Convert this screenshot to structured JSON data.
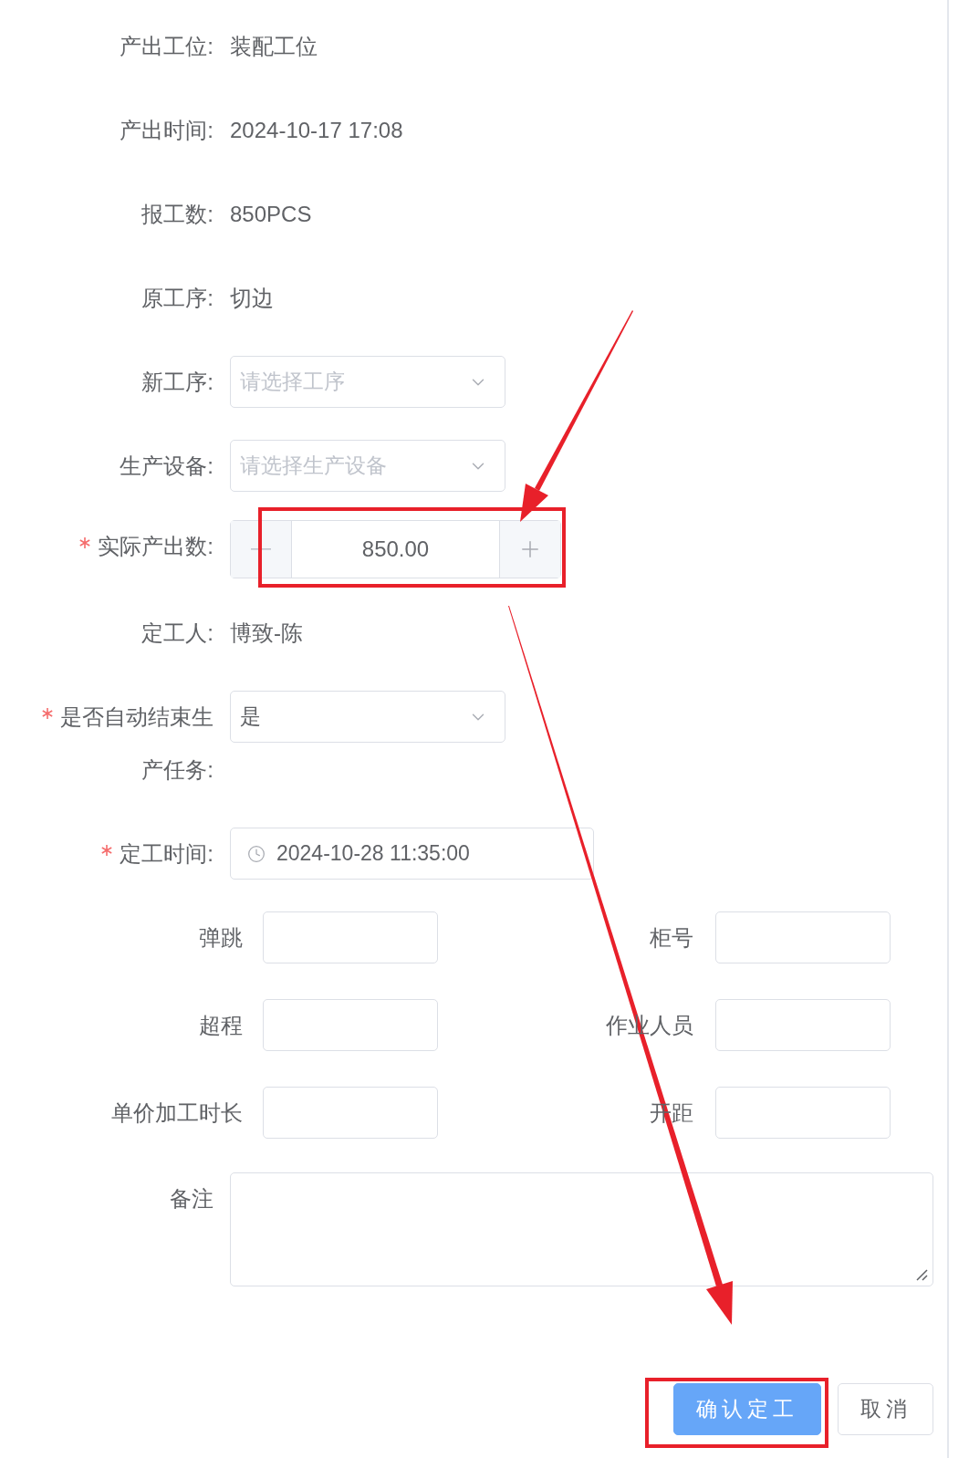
{
  "form": {
    "rows": [
      {
        "kind": "text",
        "label": "产出工位:",
        "required": false,
        "value": "装配工位"
      },
      {
        "kind": "text",
        "label": "产出时间:",
        "required": false,
        "value": "2024-10-17 17:08"
      },
      {
        "kind": "text",
        "label": "报工数:",
        "required": false,
        "value": "850PCS"
      },
      {
        "kind": "text",
        "label": "原工序:",
        "required": false,
        "value": "切边"
      },
      {
        "kind": "select",
        "label": "新工序:",
        "required": false,
        "placeholder": "请选择工序"
      },
      {
        "kind": "select",
        "label": "生产设备:",
        "required": false,
        "placeholder": "请选择生产设备"
      },
      {
        "kind": "number",
        "label": "实际产出数:",
        "required": true,
        "value": "850.00"
      },
      {
        "kind": "text",
        "label": "定工人:",
        "required": false,
        "value": "博致-陈"
      },
      {
        "kind": "select",
        "label": "是否自动结束生产任务:",
        "required": true,
        "value": "是"
      },
      {
        "kind": "datetime",
        "label": "定工时间:",
        "required": true,
        "value": "2024-10-28 11:35:00"
      }
    ],
    "extra_fields": [
      {
        "label": "弹跳"
      },
      {
        "label": "柜号"
      },
      {
        "label": "超程"
      },
      {
        "label": "作业人员"
      },
      {
        "label": "单价加工时长"
      },
      {
        "label": "开距"
      }
    ],
    "remark": {
      "label": "备注"
    },
    "buttons": [
      {
        "label": "确认定工",
        "kind": "primary"
      },
      {
        "label": "取消",
        "kind": "default"
      }
    ]
  }
}
